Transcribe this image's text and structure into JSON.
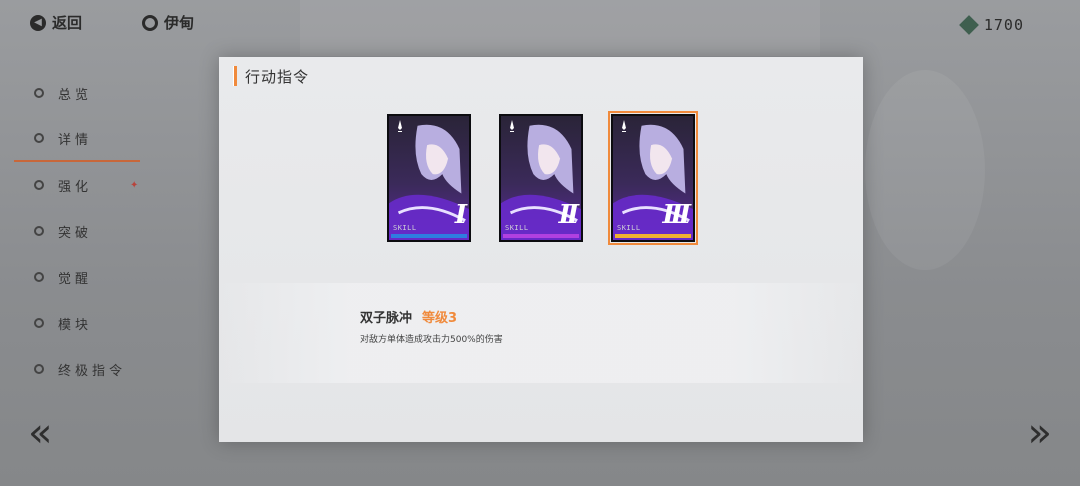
{
  "topbar": {
    "back_label": "返回",
    "character_name": "伊甸",
    "currency_value": "1700"
  },
  "sidebar": {
    "items": [
      {
        "label": "总览",
        "active": false,
        "badge": false
      },
      {
        "label": "详情",
        "active": true,
        "badge": false
      },
      {
        "label": "强化",
        "active": false,
        "badge": true
      },
      {
        "label": "突破",
        "active": false,
        "badge": false
      },
      {
        "label": "觉醒",
        "active": false,
        "badge": false
      },
      {
        "label": "模块",
        "active": false,
        "badge": false
      },
      {
        "label": "终极指令",
        "active": false,
        "badge": false
      }
    ]
  },
  "modal": {
    "title": "行动指令",
    "cards": [
      {
        "numeral": "I",
        "tag": "SKILL",
        "bar_color": "#2f7de0",
        "selected": false
      },
      {
        "numeral": "II",
        "tag": "SKILL",
        "bar_color": "#b040e0",
        "selected": false
      },
      {
        "numeral": "III",
        "tag": "SKILL",
        "bar_color": "#f0b030",
        "selected": true
      }
    ],
    "skill": {
      "name": "双子脉冲",
      "level": "等级3",
      "description": "对敌方单体造成攻击力500%的伤害"
    }
  },
  "colors": {
    "accent": "#f08a3c",
    "bar_level1": "#2f7de0",
    "bar_level2": "#b040e0",
    "bar_level3": "#f0b030"
  },
  "icons": {
    "back": "back-arrow-icon",
    "home": "ring-icon",
    "currency": "gem-icon",
    "nav_prev": "double-chevron-left-icon",
    "nav_next": "double-chevron-right-icon"
  }
}
